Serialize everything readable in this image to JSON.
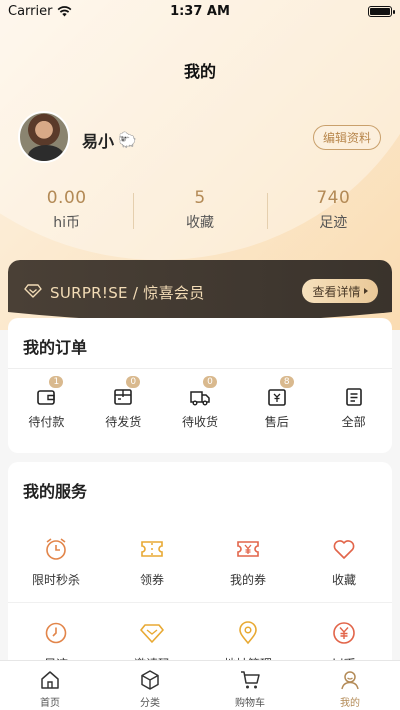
{
  "status_bar": {
    "carrier": "Carrier",
    "time": "1:37 AM"
  },
  "header": {
    "title": "我的"
  },
  "profile": {
    "name": "易小",
    "name_emoji": "🐑",
    "edit_label": "编辑资料"
  },
  "stats": [
    {
      "value": "0.00",
      "label": "hi币"
    },
    {
      "value": "5",
      "label": "收藏"
    },
    {
      "value": "740",
      "label": "足迹"
    }
  ],
  "vip": {
    "text": "SURPR!SE / 惊喜会员",
    "detail_label": "查看详情"
  },
  "orders": {
    "title": "我的订单",
    "items": [
      {
        "label": "待付款",
        "badge": "1",
        "icon": "wallet-icon"
      },
      {
        "label": "待发货",
        "badge": "0",
        "icon": "package-icon"
      },
      {
        "label": "待收货",
        "badge": "0",
        "icon": "truck-icon"
      },
      {
        "label": "售后",
        "badge": "8",
        "icon": "refund-icon"
      },
      {
        "label": "全部",
        "badge": "",
        "icon": "list-icon"
      }
    ]
  },
  "services": {
    "title": "我的服务",
    "items": [
      {
        "label": "限时秒杀",
        "icon": "alarm-clock-icon"
      },
      {
        "label": "领券",
        "icon": "ticket-icon"
      },
      {
        "label": "我的券",
        "icon": "coupon-yen-icon"
      },
      {
        "label": "收藏",
        "icon": "heart-icon"
      },
      {
        "label": "足迹",
        "icon": "clock-icon"
      },
      {
        "label": "邀请码",
        "icon": "invite-diamond-icon"
      },
      {
        "label": "地址管理",
        "icon": "location-pin-icon"
      },
      {
        "label": "hi币",
        "icon": "yen-coin-icon"
      }
    ]
  },
  "tabs": [
    {
      "label": "首页",
      "icon": "home-icon"
    },
    {
      "label": "分类",
      "icon": "category-cube-icon"
    },
    {
      "label": "购物车",
      "icon": "cart-icon"
    },
    {
      "label": "我的",
      "icon": "profile-icon"
    }
  ],
  "colors": {
    "accent": "#b38a56",
    "icon_orange": "#e2854a",
    "vip_dark": "#3f372f",
    "vip_gold": "#f3dcb6"
  }
}
